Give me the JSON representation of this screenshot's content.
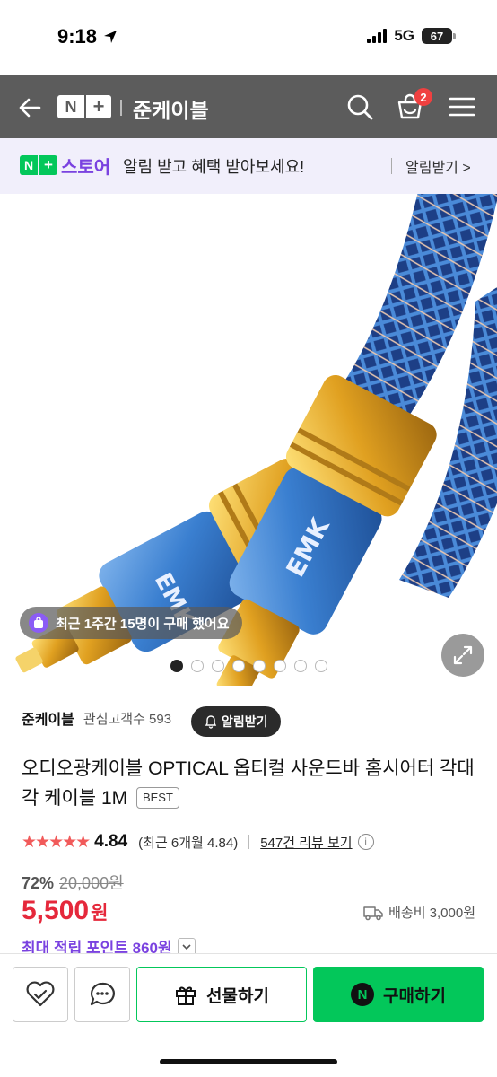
{
  "status_bar": {
    "time": "9:18",
    "network": "5G",
    "battery": "67"
  },
  "header": {
    "logo_n": "N",
    "logo_plus": "+",
    "store_name": "준케이블",
    "cart_count": "2",
    "icons": [
      "back-arrow-icon",
      "search-icon",
      "cart-icon",
      "menu-icon"
    ]
  },
  "promo": {
    "logo_n": "N",
    "logo_plus": "+",
    "store": "스토어",
    "message": "알림 받고 혜택 받아보세요!",
    "action": "알림받기 >"
  },
  "gallery": {
    "recent_purchase": "최근 1주간 15명이 구매 했어요",
    "image_count": 8,
    "active_index": 0
  },
  "seller": {
    "name": "준케이블",
    "followers": "관심고객수 593",
    "alarm_label": "알림받기"
  },
  "product": {
    "title": "오디오광케이블 OPTICAL 옵티컬 사운드바 홈시어터 각대각 케이블 1M",
    "badge": "BEST",
    "stars": "★★★★★",
    "rating": "4.84",
    "rating_recent": "(최근 6개월 4.84)",
    "review_link": "547건 리뷰 보기",
    "discount": "72%",
    "original_price": "20,000원",
    "price": "5,500",
    "price_unit": "원",
    "shipping": "배송비 3,000원",
    "points": "최대 적립 포인트 860원"
  },
  "bottom_bar": {
    "gift_label": "선물하기",
    "buy_label": "구매하기",
    "buy_icon_letter": "N"
  },
  "colors": {
    "header_bg": "#5c5c5c",
    "naver_green": "#03c75a",
    "price_red": "#e5283b",
    "points_purple": "#7a42e0",
    "star_red": "#f15a5a"
  }
}
